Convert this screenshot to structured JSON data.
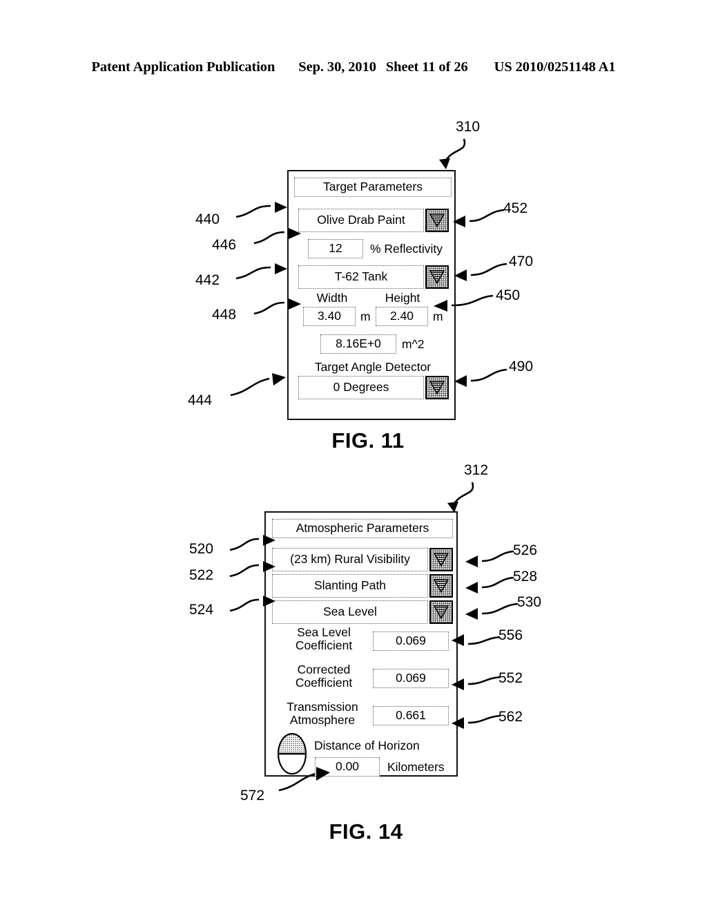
{
  "header": {
    "publication": "Patent Application Publication",
    "date": "Sep. 30, 2010",
    "sheet": "Sheet 11 of 26",
    "patent_number": "US 2010/0251148 A1"
  },
  "figures": [
    {
      "id": "fig11",
      "caption": "FIG. 11",
      "panel_ref": "310",
      "title": "Target Parameters",
      "fields": {
        "paint_material": "Olive Drab Paint",
        "reflectivity_value": "12",
        "reflectivity_label": "% Reflectivity",
        "target_type": "T-62 Tank",
        "width_label": "Width",
        "height_label": "Height",
        "width_value": "3.40",
        "width_unit": "m",
        "height_value": "2.40",
        "height_unit": "m",
        "area_value": "8.16E+0",
        "area_unit": "m^2",
        "angle_detector_label": "Target Angle Detector",
        "angle_value": "0 Degrees"
      },
      "refs": {
        "paint_combo": "440",
        "reflectivity": "446",
        "target_combo": "442",
        "dimensions": "448",
        "angle_section": "444",
        "paint_dropdown": "452",
        "target_dropdown": "470",
        "height_field": "450",
        "angle_dropdown": "490"
      }
    },
    {
      "id": "fig14",
      "caption": "FIG. 14",
      "panel_ref": "312",
      "title": "Atmospheric Parameters",
      "fields": {
        "visibility": "(23 km)  Rural Visibility",
        "path": "Slanting Path",
        "altitude": "Sea Level",
        "sea_level_coefficient_label": "Sea Level\nCoefficient",
        "sea_level_coefficient_value": "0.069",
        "corrected_coefficient_label": "Corrected\nCoefficient",
        "corrected_coefficient_value": "0.069",
        "transmission_atmosphere_label": "Transmission\nAtmosphere",
        "transmission_atmosphere_value": "0.661",
        "distance_of_horizon_label": "Distance of Horizon",
        "distance_of_horizon_value": "0.00",
        "distance_of_horizon_unit": "Kilometers"
      },
      "refs": {
        "visibility": "520",
        "path": "522",
        "altitude": "524",
        "visibility_dropdown": "526",
        "path_dropdown": "528",
        "altitude_dropdown": "530",
        "sea_level_coefficient": "556",
        "corrected_coefficient": "552",
        "transmission_atmosphere": "562",
        "distance_of_horizon": "572"
      }
    }
  ],
  "icons": {
    "dropdown": "triangle-down-icon",
    "horizon": "horizon-ellipse-icon"
  }
}
